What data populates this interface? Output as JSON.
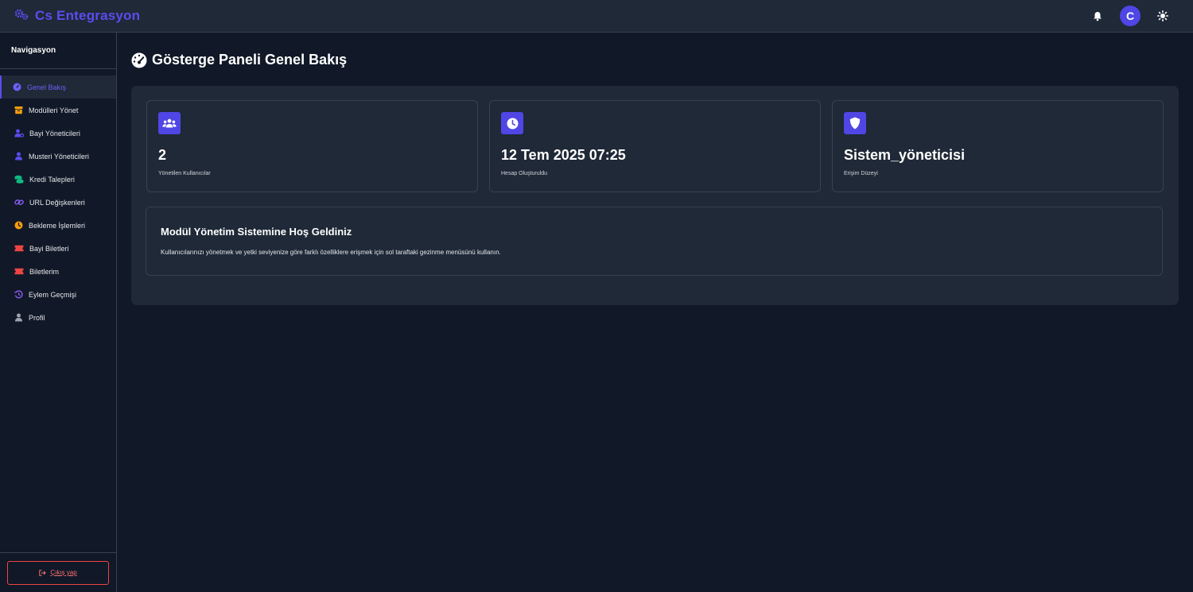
{
  "header": {
    "brand_title": "Cs Entegrasyon",
    "brand_icon": "gears-icon",
    "avatar_letter": "C",
    "accent_color": "#5b4cf0"
  },
  "sidebar": {
    "heading": "Navigasyon",
    "items": [
      {
        "label": "Genel Bakış",
        "icon": "gauge-icon",
        "active": true
      },
      {
        "label": "Modülleri Yönet",
        "icon": "box-icon"
      },
      {
        "label": "Bayi Yöneticileri",
        "icon": "user-gear-icon"
      },
      {
        "label": "Musteri Yöneticileri",
        "icon": "user-icon"
      },
      {
        "label": "Kredi Talepleri",
        "icon": "coins-icon"
      },
      {
        "label": "URL Değişkenleri",
        "icon": "link-icon"
      },
      {
        "label": "Bekleme İşlemleri",
        "icon": "clock-icon"
      },
      {
        "label": "Bayi Biletleri",
        "icon": "ticket-icon"
      },
      {
        "label": "Biletlerim",
        "icon": "ticket-icon"
      },
      {
        "label": "Eylem Geçmişi",
        "icon": "history-icon"
      },
      {
        "label": "Profil",
        "icon": "user-icon"
      }
    ],
    "logout_label": "Çıkış yap"
  },
  "main": {
    "page_title": "Gösterge Paneli Genel Bakış",
    "stats": [
      {
        "value": "2",
        "label": "Yönetilen Kullanıcılar",
        "icon": "users-icon"
      },
      {
        "value": "12 Tem 2025 07:25",
        "label": "Hesap Oluşturuldu",
        "icon": "clock-icon"
      },
      {
        "value": "Sistem_yöneticisi",
        "label": "Erişim Düzeyi",
        "icon": "shield-icon"
      }
    ],
    "welcome": {
      "title": "Modül Yönetim Sistemine Hoş Geldiniz",
      "text": "Kullanıcılarınızı yönetmek ve yetki seviyenize göre farklı özelliklere erişmek için sol taraftaki gezinme menüsünü kullanın."
    }
  }
}
